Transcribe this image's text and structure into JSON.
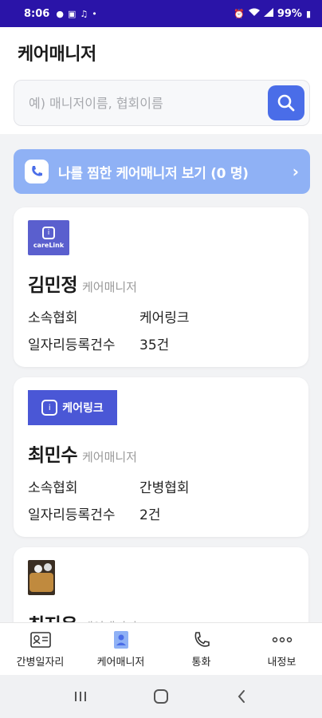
{
  "status_bar": {
    "time": "8:06",
    "battery": "99%"
  },
  "header": {
    "title": "케어매니저"
  },
  "search": {
    "placeholder": "예) 매니저이름, 협회이름",
    "value": ""
  },
  "zzim_banner": {
    "label": "나를 찜한 케어매니저 보기 (0 명)",
    "chevron": "›"
  },
  "cards": [
    {
      "logo_text": "careLink",
      "name": "김민정",
      "role": "케어매니저",
      "fields": [
        {
          "key": "소속협회",
          "value": "케어링크"
        },
        {
          "key": "일자리등록건수",
          "value": "35건"
        }
      ]
    },
    {
      "logo_text": "케어링크",
      "name": "최민수",
      "role": "케어매니저",
      "fields": [
        {
          "key": "소속협회",
          "value": "간병협회"
        },
        {
          "key": "일자리등록건수",
          "value": "2건"
        }
      ]
    },
    {
      "name": "최지은",
      "role": "케어매니저"
    }
  ],
  "bottom_nav": [
    {
      "label": "간병일자리",
      "icon": "id-card-icon"
    },
    {
      "label": "케어매니저",
      "icon": "person-badge-icon"
    },
    {
      "label": "통화",
      "icon": "phone-icon"
    },
    {
      "label": "내정보",
      "icon": "more-dots-icon"
    }
  ],
  "colors": {
    "status_bar": "#2a14a8",
    "accent": "#4a6de8",
    "banner": "#8fb1f5"
  }
}
